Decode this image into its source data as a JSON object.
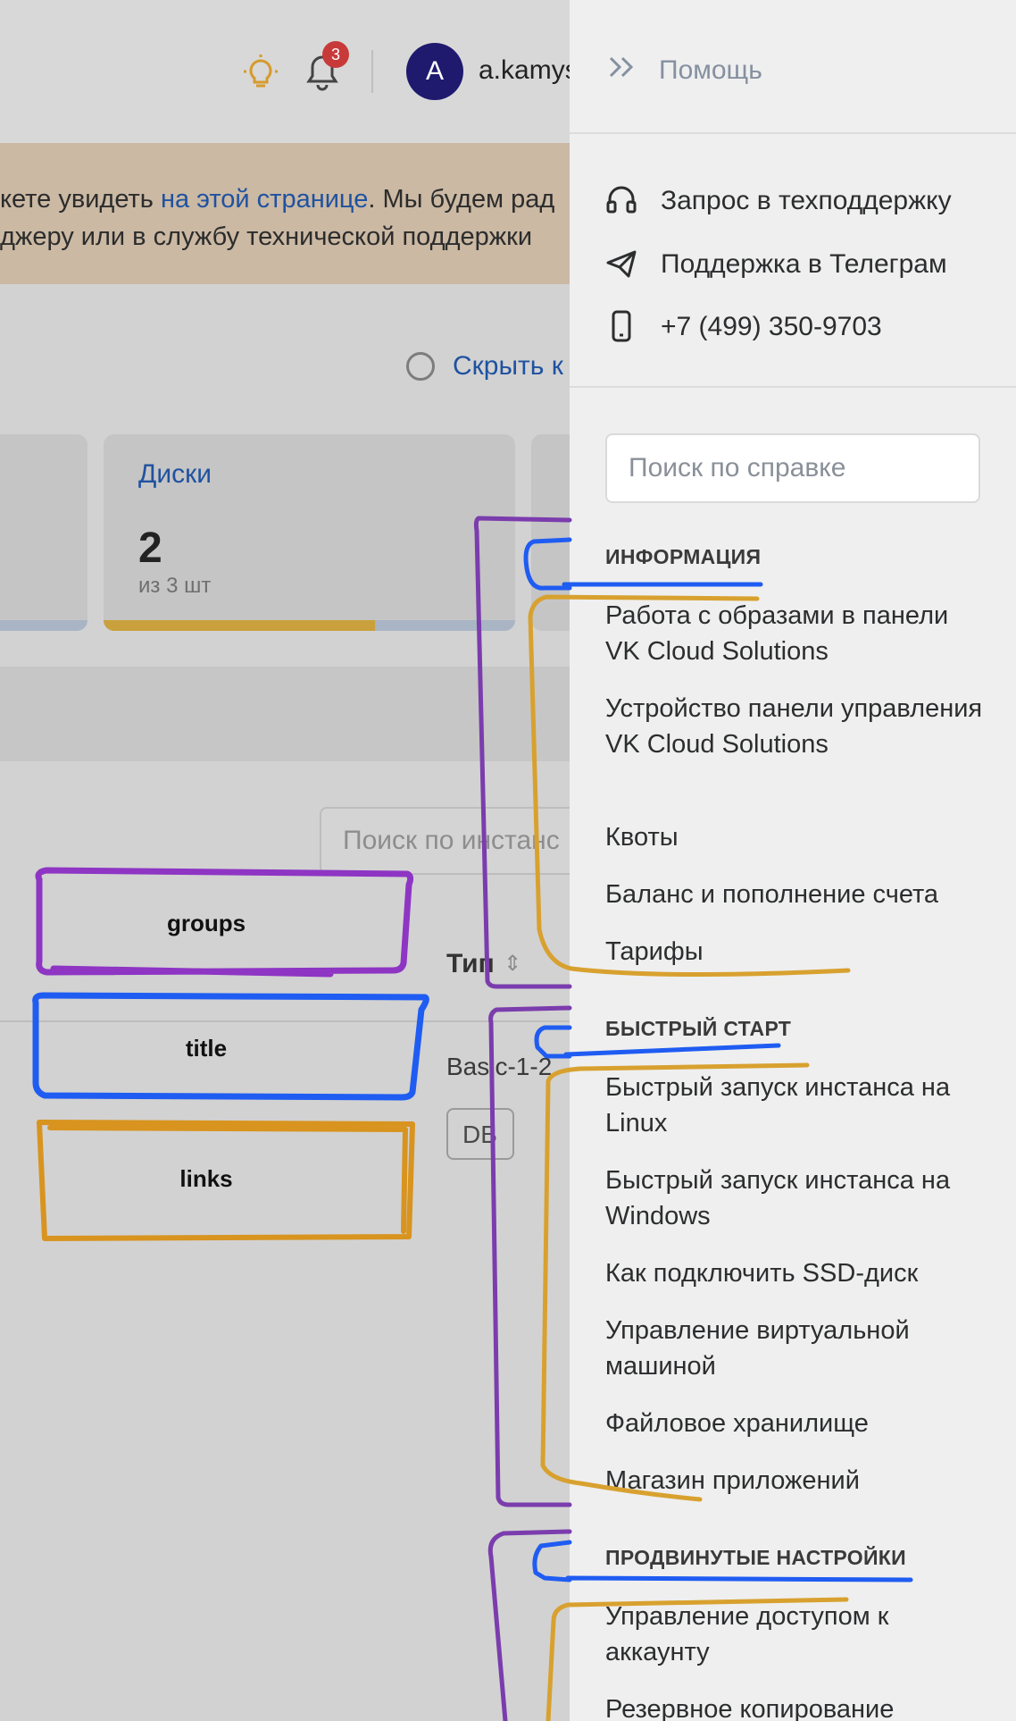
{
  "header": {
    "notifications_count": "3",
    "avatar_letter": "A",
    "username": "a.kamys"
  },
  "banner": {
    "line1_prefix": "кете увидеть ",
    "line1_link": "на этой странице",
    "line1_suffix": ". Мы будем рад",
    "line2": "джеру или в службу технической поддержки"
  },
  "toolbar": {
    "hide_label": "Скрыть к"
  },
  "quota_card": {
    "title": "Диски",
    "value": "2",
    "sub": "из 3 шт",
    "fill": 0.66
  },
  "instances": {
    "search_placeholder": "Поиск по инстанс",
    "col_type": "Тип",
    "row_type": "Basic-1-2",
    "row_tag": "DB"
  },
  "help_panel": {
    "title": "Помощь",
    "contacts": [
      {
        "icon": "headset-icon",
        "label": "Запрос в техподдержку"
      },
      {
        "icon": "telegram-icon",
        "label": "Поддержка в Телеграм"
      },
      {
        "icon": "phone-icon",
        "label": "+7 (499) 350-9703"
      }
    ],
    "search_placeholder": "Поиск по справке",
    "sections": [
      {
        "title": "ИНФОРМАЦИЯ",
        "links": [
          "Работа с образами в панели VK Cloud Solutions",
          "Устройство панели управления VK Cloud Solutions",
          "Квоты",
          "Баланс и пополнение счета",
          "Тарифы"
        ]
      },
      {
        "title": "БЫСТРЫЙ СТАРТ",
        "links": [
          "Быстрый запуск инстанса на Linux",
          "Быстрый запуск инстанса на Windows",
          "Как подключить SSD-диск",
          "Управление виртуальной машиной",
          "Файловое хранилище",
          "Магазин приложений"
        ]
      },
      {
        "title": "ПРОДВИНУТЫЕ НАСТРОЙКИ",
        "links": [
          "Управление доступом к аккаунту",
          "Резервное копирование"
        ]
      }
    ]
  },
  "annotations": {
    "legend": [
      "groups",
      "title",
      "links"
    ],
    "colors": {
      "groups": "#8e35c4",
      "title": "#1f5cf2",
      "links": "#d8941f"
    }
  }
}
